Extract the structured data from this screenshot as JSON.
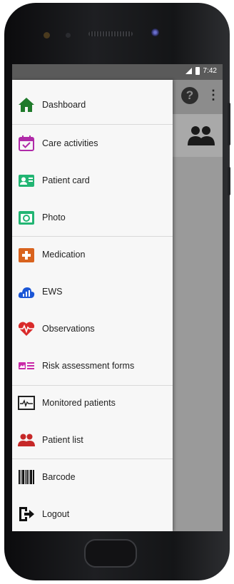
{
  "status_bar": {
    "time": "7:42"
  },
  "toolbar": {
    "help_icon": "help-circle-icon",
    "more_icon": "more-vert-icon"
  },
  "subheader": {
    "icon": "people-icon"
  },
  "menu": {
    "items": [
      {
        "label": "Dashboard",
        "icon": "home-icon",
        "color": "#1f7a2a"
      },
      {
        "label": "Care activities",
        "icon": "calendar-check-icon",
        "color": "#b02aa8"
      },
      {
        "label": "Patient card",
        "icon": "id-card-icon",
        "color": "#22b573"
      },
      {
        "label": "Photo",
        "icon": "camera-icon",
        "color": "#22b573"
      },
      {
        "label": "Medication",
        "icon": "first-aid-icon",
        "color": "#d9631e"
      },
      {
        "label": "EWS",
        "icon": "cloud-chart-icon",
        "color": "#1b56d6"
      },
      {
        "label": "Observations",
        "icon": "heart-pulse-icon",
        "color": "#d92b2b"
      },
      {
        "label": "Risk assessment forms",
        "icon": "form-list-icon",
        "color": "#c92aa8"
      },
      {
        "label": "Monitored patients",
        "icon": "monitor-icon",
        "color": "#222222"
      },
      {
        "label": "Patient list",
        "icon": "people-icon",
        "color": "#c62828"
      },
      {
        "label": "Barcode",
        "icon": "barcode-icon",
        "color": "#111111"
      },
      {
        "label": "Logout",
        "icon": "logout-icon",
        "color": "#111111"
      }
    ]
  }
}
